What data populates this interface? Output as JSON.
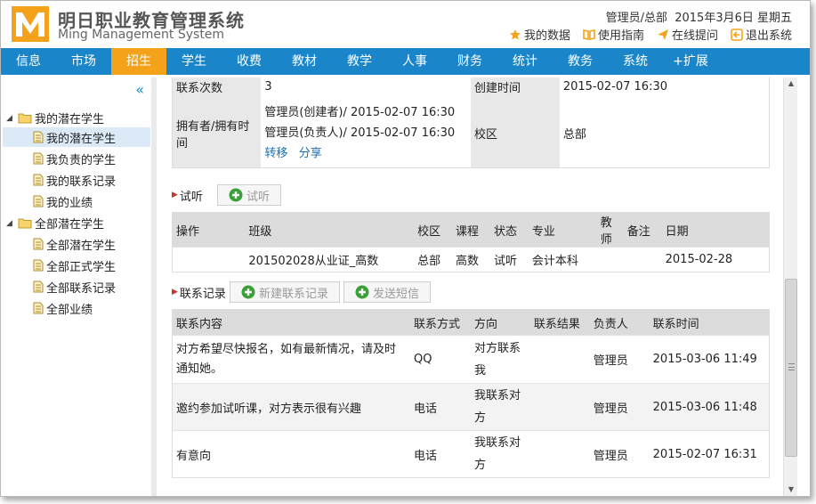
{
  "header": {
    "title": "明日职业教育管理系统",
    "subtitle": "Ming Management System",
    "user": "管理员/总部",
    "date": "2015年3月6日 星期五",
    "links": [
      {
        "label": "我的数据",
        "icon": "star-icon"
      },
      {
        "label": "使用指南",
        "icon": "book-icon"
      },
      {
        "label": "在线提问",
        "icon": "send-icon"
      },
      {
        "label": "退出系统",
        "icon": "exit-icon"
      }
    ]
  },
  "nav": {
    "items": [
      "信息",
      "市场",
      "招生",
      "学生",
      "收费",
      "教材",
      "教学",
      "人事",
      "财务",
      "统计",
      "教务",
      "系统",
      "+扩展"
    ],
    "active_index": 2
  },
  "sidebar": {
    "collapse": "«",
    "groups": [
      {
        "label": "我的潜在学生",
        "items": [
          "我的潜在学生",
          "我负责的学生",
          "我的联系记录",
          "我的业绩"
        ]
      },
      {
        "label": "全部潜在学生",
        "items": [
          "全部潜在学生",
          "全部正式学生",
          "全部联系记录",
          "全部业绩"
        ]
      }
    ],
    "selected": "我的潜在学生"
  },
  "info": {
    "contact_count_label": "联系次数",
    "contact_count": "3",
    "created_label": "创建时间",
    "created": "2015-02-07 16:30",
    "owner_label": "拥有者/拥有时间",
    "owner_line1": "管理员(创建者)/ 2015-02-07 16:30",
    "owner_line2": "管理员(负责人)/ 2015-02-07 16:30",
    "transfer_link": "转移",
    "share_link": "分享",
    "campus_label": "校区",
    "campus": "总部"
  },
  "trial": {
    "section": "试听",
    "button": "试听",
    "columns": [
      "操作",
      "班级",
      "校区",
      "课程",
      "状态",
      "专业",
      "教师",
      "备注",
      "日期"
    ],
    "rows": [
      [
        "",
        "201502028从业证_高数",
        "总部",
        "高数",
        "试听",
        "会计本科",
        "",
        "",
        "2015-02-28"
      ]
    ]
  },
  "contacts": {
    "section": "联系记录",
    "new_button": "新建联系记录",
    "sms_button": "发送短信",
    "columns": [
      "联系内容",
      "联系方式",
      "方向",
      "联系结果",
      "负责人",
      "联系时间"
    ],
    "rows": [
      [
        "对方希望尽快报名，如有最新情况，请及时通知她。",
        "QQ",
        "对方联系我",
        "",
        "管理员",
        "2015-03-06 11:49"
      ],
      [
        "邀约参加试听课，对方表示很有兴趣",
        "电话",
        "我联系对方",
        "",
        "管理员",
        "2015-03-06 11:48"
      ],
      [
        "有意向",
        "电话",
        "我联系对方",
        "",
        "管理员",
        "2015-02-07 16:31"
      ]
    ]
  },
  "colors": {
    "nav": "#1a86c9",
    "nav_active": "#f5a21b",
    "logo": "#f5a21b"
  }
}
